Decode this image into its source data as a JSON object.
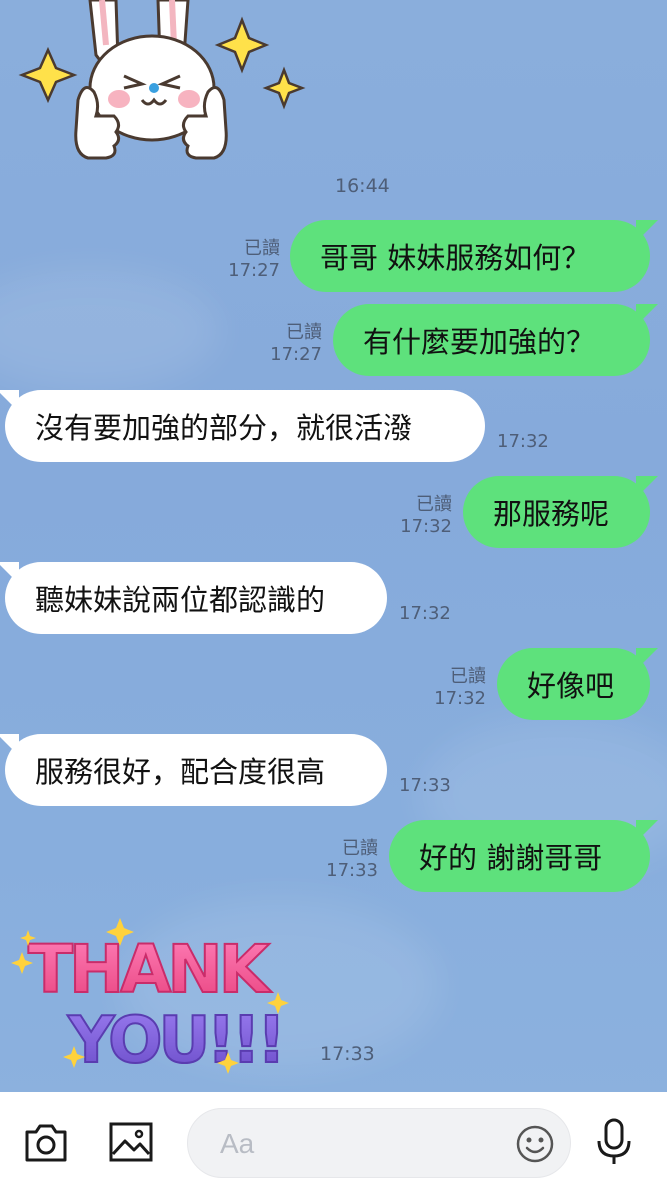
{
  "chat": {
    "date_time_sticker_1": "16:44",
    "messages": [
      {
        "direction": "out",
        "text": "哥哥 妹妹服務如何？",
        "read": "已讀",
        "time": "17:27"
      },
      {
        "direction": "out",
        "text": "有什麼要加強的？",
        "read": "已讀",
        "time": "17:27"
      },
      {
        "direction": "in",
        "text": "沒有要加強的部分，就很活潑",
        "time": "17:32"
      },
      {
        "direction": "out",
        "text": "那服務呢",
        "read": "已讀",
        "time": "17:32"
      },
      {
        "direction": "in",
        "text": "聽妹妹說兩位都認識的",
        "time": "17:32"
      },
      {
        "direction": "out",
        "text": "好像吧",
        "read": "已讀",
        "time": "17:32"
      },
      {
        "direction": "in",
        "text": "服務很好，配合度很高",
        "time": "17:33"
      },
      {
        "direction": "out",
        "text": "好的 謝謝哥哥",
        "read": "已讀",
        "time": "17:33"
      }
    ],
    "sticker_thankyou": {
      "line1": "THANK",
      "line2": "YOU!!!",
      "time": "17:33"
    }
  },
  "composer": {
    "placeholder": "Aa",
    "icons": [
      "camera-icon",
      "image-icon",
      "emoji-icon",
      "microphone-icon"
    ]
  },
  "colors": {
    "outgoing_bubble": "#5ee17c",
    "incoming_bubble": "#ffffff",
    "background": "#88aedd"
  }
}
